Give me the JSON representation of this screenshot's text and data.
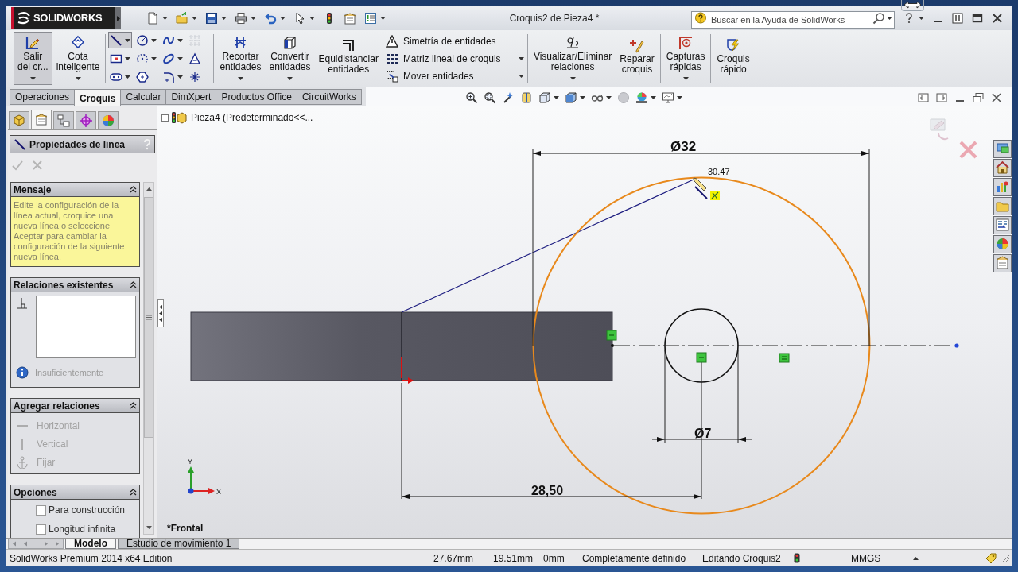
{
  "window": {
    "logo": "SOLIDWORKS",
    "title": "Croquis2 de Pieza4 *"
  },
  "search": {
    "placeholder": "Buscar en la Ayuda de SolidWorks"
  },
  "ribbon": {
    "groups": [
      {
        "items": [
          {
            "kind": "large",
            "label": "Salir\ndel cr...",
            "active": true,
            "dropdown": true
          },
          {
            "kind": "large",
            "label": "Cota\ninteligente",
            "active": false,
            "dropdown": true
          }
        ]
      },
      {
        "items": [
          {
            "kind": "tools",
            "tools": [
              {
                "selected": true,
                "disabled": false,
                "dropdown": true
              },
              {
                "selected": false,
                "disabled": false,
                "dropdown": true
              },
              {
                "selected": false,
                "disabled": false,
                "dropdown": true
              },
              {
                "selected": false,
                "disabled": true,
                "dropdown": false
              },
              {
                "selected": false,
                "disabled": false,
                "dropdown": true
              },
              {
                "selected": false,
                "disabled": false,
                "dropdown": true
              },
              {
                "selected": false,
                "disabled": false,
                "dropdown": true
              },
              {
                "selected": false,
                "disabled": false,
                "dropdown": false
              },
              {
                "selected": false,
                "disabled": false,
                "dropdown": true
              },
              {
                "selected": false,
                "disabled": false,
                "dropdown": false
              },
              {
                "selected": false,
                "disabled": false,
                "dropdown": true
              },
              {
                "selected": false,
                "disabled": false,
                "dropdown": false
              }
            ]
          }
        ]
      },
      {
        "items": [
          {
            "kind": "large",
            "label": "Recortar\nentidades",
            "active": false,
            "dropdown": true
          },
          {
            "kind": "large",
            "label": "Convertir\nentidades",
            "active": false,
            "dropdown": true
          },
          {
            "kind": "large",
            "label": "Equidistanciar\nentidades",
            "active": false,
            "dropdown": false
          },
          {
            "kind": "stack",
            "rows": [
              {
                "label": "Simetría de entidades",
                "dropdown": false
              },
              {
                "label": "Matriz lineal de croquis",
                "dropdown": true
              },
              {
                "label": "Mover entidades",
                "dropdown": true
              }
            ]
          }
        ]
      },
      {
        "items": [
          {
            "kind": "large",
            "label": "Visualizar/Eliminar\nrelaciones",
            "active": false,
            "dropdown": true
          },
          {
            "kind": "large",
            "label": "Reparar\ncroquis",
            "active": false,
            "dropdown": false
          }
        ]
      },
      {
        "items": [
          {
            "kind": "large",
            "label": "Capturas\nrápidas",
            "active": false,
            "dropdown": true
          }
        ]
      },
      {
        "items": [
          {
            "kind": "large",
            "label": "Croquis\nrápido",
            "active": false,
            "dropdown": false
          }
        ]
      }
    ]
  },
  "tabs": [
    {
      "label": "Operaciones",
      "selected": false
    },
    {
      "label": "Croquis",
      "selected": true
    },
    {
      "label": "Calcular",
      "selected": false
    },
    {
      "label": "DimXpert",
      "selected": false
    },
    {
      "label": "Productos Office",
      "selected": false
    },
    {
      "label": "CircuitWorks",
      "selected": false
    }
  ],
  "tree": {
    "root": "Pieza4 (Predeterminado<<...",
    "expanded": false
  },
  "property_manager": {
    "panel_tabs": [
      {
        "selected": false
      },
      {
        "selected": true
      },
      {
        "selected": false
      },
      {
        "selected": false
      },
      {
        "selected": false
      }
    ],
    "title": "Propiedades de línea",
    "groups": [
      {
        "kind": "message",
        "title": "Mensaje",
        "expanded": true,
        "text": "Edite la configuración de la línea actual, croquice una nueva línea o seleccione Aceptar para cambiar la configuración de la siguiente nueva línea."
      },
      {
        "kind": "relations",
        "title": "Relaciones existentes",
        "expanded": true,
        "status": "Insuficientemente"
      },
      {
        "kind": "add_relations",
        "title": "Agregar relaciones",
        "expanded": true,
        "items": [
          {
            "label": "Horizontal",
            "disabled": true
          },
          {
            "label": "Vertical",
            "disabled": true
          },
          {
            "label": "Fijar",
            "disabled": true
          }
        ]
      },
      {
        "kind": "options",
        "title": "Opciones",
        "expanded": true,
        "items": [
          {
            "label": "Para construcción",
            "checked": false
          },
          {
            "label": "Longitud infinita",
            "checked": false
          }
        ]
      }
    ]
  },
  "graphics": {
    "outer_diameter": "Ø32",
    "cursor_length": "30.47",
    "hole_diameter": "Ø7",
    "distance": "28,50",
    "triad": {
      "y": "Y",
      "x": "X"
    },
    "view_name": "*Frontal"
  },
  "model_tabs": [
    {
      "label": "Modelo",
      "selected": true
    },
    {
      "label": "Estudio de movimiento 1",
      "selected": false
    }
  ],
  "status_bar": {
    "product": "SolidWorks Premium 2014 x64 Edition",
    "x": "27.67mm",
    "y": "19.51mm",
    "z": "0mm",
    "sketch_state": "Completamente definido",
    "editing": "Editando Croquis2",
    "units": "MMGS"
  }
}
